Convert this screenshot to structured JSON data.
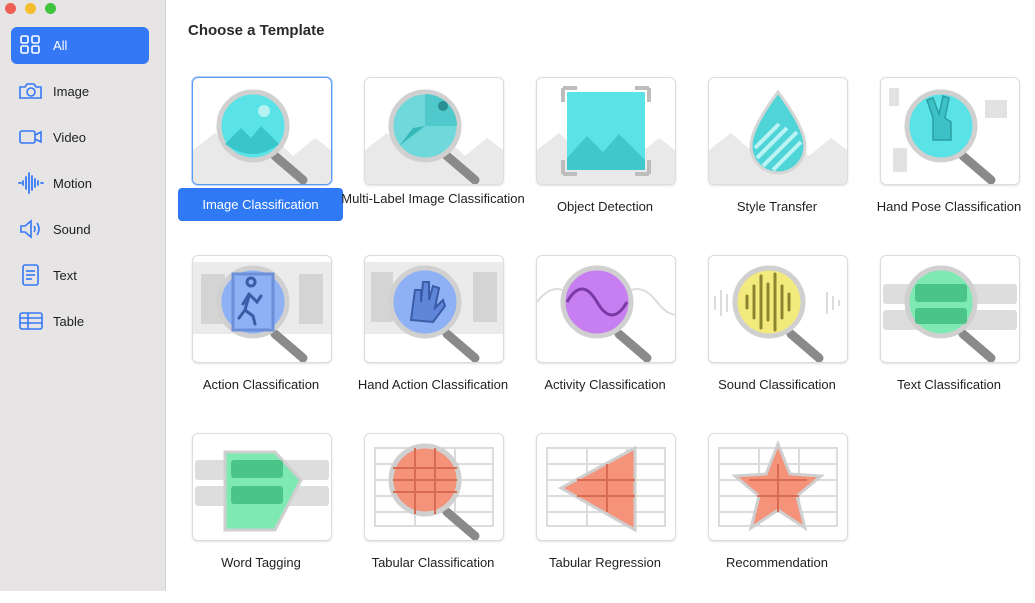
{
  "sidebar": {
    "items": [
      {
        "label": "All",
        "icon": "grid-icon",
        "selected": true
      },
      {
        "label": "Image",
        "icon": "camera-icon"
      },
      {
        "label": "Video",
        "icon": "video-camera-icon"
      },
      {
        "label": "Motion",
        "icon": "waveform-icon"
      },
      {
        "label": "Sound",
        "icon": "speaker-icon"
      },
      {
        "label": "Text",
        "icon": "document-icon"
      },
      {
        "label": "Table",
        "icon": "table-icon"
      }
    ]
  },
  "main": {
    "title": "Choose a Template",
    "templates": [
      {
        "label": "Image Classification",
        "icon": "image-magnifier-icon",
        "selected": true
      },
      {
        "label": "Multi-Label Image Classification",
        "icon": "multi-label-magnifier-icon"
      },
      {
        "label": "Object Detection",
        "icon": "object-frame-icon"
      },
      {
        "label": "Style Transfer",
        "icon": "style-drop-icon"
      },
      {
        "label": "Hand Pose Classification",
        "icon": "hand-pose-magnifier-icon"
      },
      {
        "label": "Action Classification",
        "icon": "action-runner-magnifier-icon"
      },
      {
        "label": "Hand Action Classification",
        "icon": "hand-action-magnifier-icon"
      },
      {
        "label": "Activity Classification",
        "icon": "activity-wave-magnifier-icon"
      },
      {
        "label": "Sound Classification",
        "icon": "sound-magnifier-icon"
      },
      {
        "label": "Text Classification",
        "icon": "text-magnifier-icon"
      },
      {
        "label": "Word Tagging",
        "icon": "word-tag-icon"
      },
      {
        "label": "Tabular Classification",
        "icon": "table-magnifier-icon"
      },
      {
        "label": "Tabular Regression",
        "icon": "table-regression-icon"
      },
      {
        "label": "Recommendation",
        "icon": "star-table-icon"
      }
    ]
  },
  "colors": {
    "accent": "#3478f6",
    "cyan": "#59e3e6",
    "violet": "#c77ef0",
    "yellow": "#f2ea7c",
    "green": "#7ee9b3",
    "salmon": "#f4927a"
  }
}
